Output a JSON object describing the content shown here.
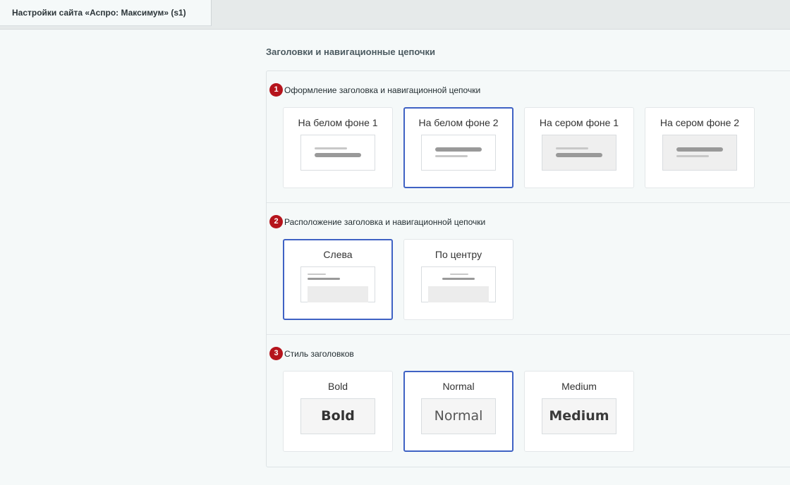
{
  "tab": {
    "label": "Настройки сайта «Аспро: Максимум» (s1)"
  },
  "page_title": "Заголовки и навигационные цепочки",
  "sections": [
    {
      "number": "1",
      "label": "Оформление заголовка и навигационной цепочки",
      "options": [
        {
          "label": "На белом фоне 1",
          "selected": false
        },
        {
          "label": "На белом фоне 2",
          "selected": true
        },
        {
          "label": "На сером фоне 1",
          "selected": false
        },
        {
          "label": "На сером фоне 2",
          "selected": false
        }
      ]
    },
    {
      "number": "2",
      "label": "Расположение заголовка и навигационной цепочки",
      "options": [
        {
          "label": "Слева",
          "selected": true
        },
        {
          "label": "По центру",
          "selected": false
        }
      ]
    },
    {
      "number": "3",
      "label": "Стиль заголовков",
      "options": [
        {
          "label": "Bold",
          "sample": "Bold",
          "selected": false
        },
        {
          "label": "Normal",
          "sample": "Normal",
          "selected": true
        },
        {
          "label": "Medium",
          "sample": "Medium",
          "selected": false
        }
      ]
    }
  ],
  "colors": {
    "accent": "#3f62c4",
    "badge": "#b5141c"
  }
}
